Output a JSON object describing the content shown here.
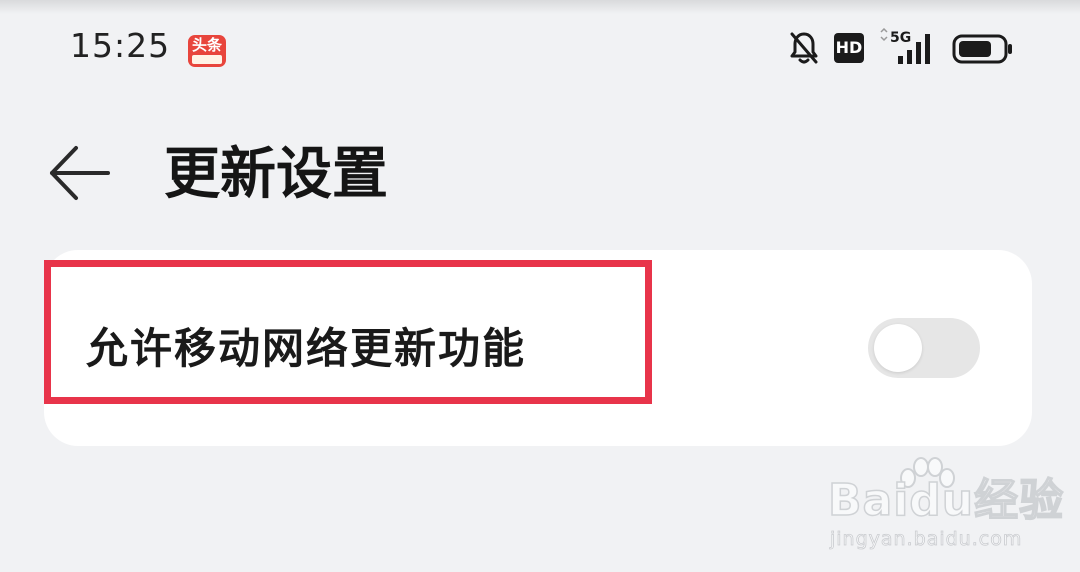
{
  "status_bar": {
    "time": "15:25",
    "app_badge_text": "头条",
    "hd_label": "HD",
    "network_label": "5G",
    "icons": [
      "bell-off-icon",
      "hd-icon",
      "signal-5g-icon",
      "battery-icon"
    ]
  },
  "header": {
    "back_icon": "arrow-left-icon",
    "title": "更新设置"
  },
  "settings": {
    "items": [
      {
        "label": "允许移动网络更新功能",
        "toggle_on": false
      }
    ]
  },
  "annotation": {
    "highlight_color": "#e8344a"
  },
  "watermark": {
    "main_text": "Baidu经验",
    "sub_text": "jingyan.baidu.com"
  },
  "colors": {
    "background": "#f1f2f4",
    "card": "#ffffff",
    "toggle_off": "#e6e6e6"
  }
}
